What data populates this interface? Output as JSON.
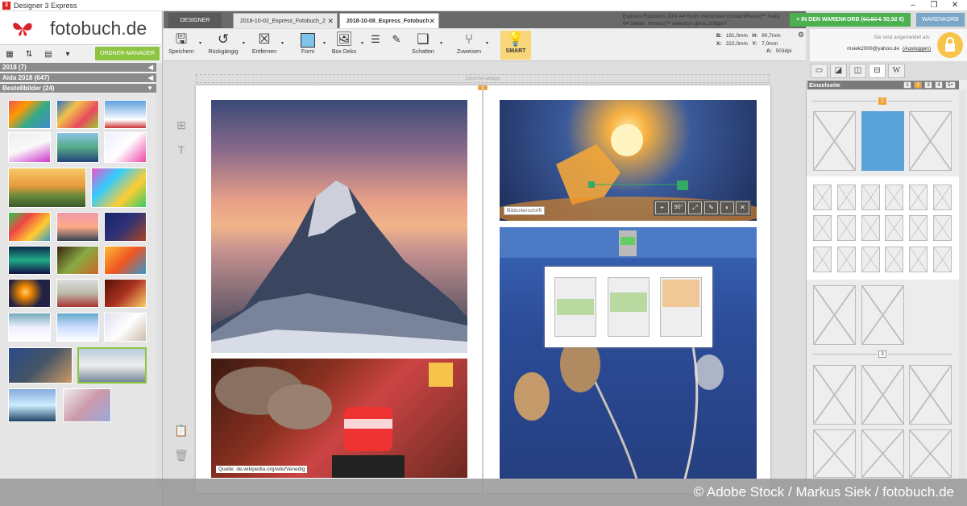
{
  "window": {
    "title": "Designer 3 Express",
    "app_icon": "3",
    "minimize": "–",
    "maximize": "❐",
    "close": "✕"
  },
  "brand": {
    "name": "fotobuch.de"
  },
  "left": {
    "tool_icons": [
      "grid-view-icon",
      "sort-icon",
      "layout-icon",
      "dropdown-icon"
    ],
    "ordner_manager": "ORDNER-MANAGER",
    "folders": [
      {
        "label": "2018 (7)",
        "arrow": "◀"
      },
      {
        "label": "Aida 2018 (647)",
        "arrow": "◀"
      },
      {
        "label": "Bestellbilder (24)",
        "arrow": "▼"
      }
    ]
  },
  "tabs": {
    "designer": "DESIGNER",
    "docs": [
      {
        "label": "2018-10-02_Express_Fotobuch_2",
        "close": "✕"
      },
      {
        "label": "2018-10-08_Express_Fotobuch",
        "close": "✕"
      }
    ]
  },
  "product": {
    "line1": "Express Fotobuch, DIN A4 Hoch, Hardcover (ScratchResist™ matt)",
    "line2": "64 Seiten, fomanu™ selection gloss 200g/m²"
  },
  "cart": {
    "label": "IN DEN WARENKORB",
    "old_price": "60,90 €",
    "new_price": "50,92 €",
    "warenkorb": "WARENKORB"
  },
  "toolbar": {
    "save": "Speichern",
    "undo": "Rückgängig",
    "remove": "Entfernen",
    "shape": "Form",
    "boxdeko": "Box Deko",
    "shadow": "Schatten",
    "assign": "Zuweisen",
    "smart": "SMART"
  },
  "dims": {
    "B": "191,0mm",
    "H": "90,7mm",
    "X": "222,0mm",
    "Y": "7,0mm",
    "A": "503dpi"
  },
  "account": {
    "logged_in_as": "Sie sind angemeldet als:",
    "email": "msiek2000@yahoo.de",
    "logout": "(Ausloggen)"
  },
  "canvas": {
    "zwischenablage": "Zwischenablage",
    "caption_source": "Quelle: de.wikipedia.org/wiki/Venedig",
    "caption_bild": "Bildunterschrift",
    "image_tools": [
      "⌖",
      "90°",
      "⤢",
      "✎",
      "◐",
      "✕"
    ]
  },
  "right": {
    "panel_title": "Einzelseite",
    "pages": [
      "1",
      "2",
      "3",
      "4",
      "5+"
    ],
    "active_page": "2",
    "section_labels": [
      "2",
      "3"
    ],
    "tab_w": "W"
  },
  "footer": {
    "credit": "© Adobe Stock / Markus Siek / fotobuch.de"
  }
}
